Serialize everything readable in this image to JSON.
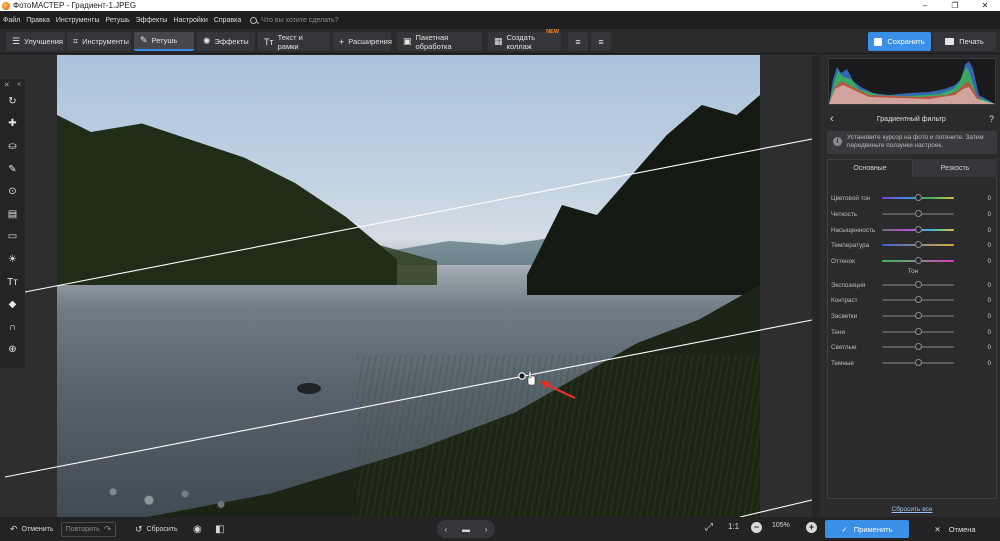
{
  "window": {
    "title": "ФотоМАСТЕР - Градиент-1.JPEG",
    "minimize": "–",
    "maximize": "❐",
    "close": "✕"
  },
  "menu": {
    "items": [
      "Файл",
      "Правка",
      "Инструменты",
      "Ретушь",
      "Эффекты",
      "Настройки",
      "Справка"
    ],
    "search_placeholder": "Что вы хотите сделать?"
  },
  "toolbar": {
    "tabs": [
      {
        "label": "Улучшения",
        "icon": "☰"
      },
      {
        "label": "Инструменты",
        "icon": "⌗"
      },
      {
        "label": "Ретушь",
        "icon": "✎"
      },
      {
        "label": "Эффекты",
        "icon": "✺"
      },
      {
        "label": "Текст и рамки",
        "icon": "Tт"
      },
      {
        "label": "Расширения",
        "icon": "+"
      },
      {
        "label": "Пакетная обработка",
        "icon": "▣"
      },
      {
        "label": "Создать коллаж",
        "icon": "▦",
        "badge": "NEW"
      }
    ],
    "extra1": "≡",
    "extra2": "≡",
    "save_label": "Сохранить",
    "print_label": "Печать"
  },
  "left_tools": {
    "collapse_close": "✕",
    "collapse_arrow": "«",
    "icons": [
      "↻",
      "✚",
      "⛀",
      "✎",
      "⊙",
      "▤",
      "▭",
      "☀",
      "Tт",
      "◆",
      "∩",
      "⊕"
    ]
  },
  "panel": {
    "back": "‹",
    "title": "Градиентный фильтр",
    "help": "?",
    "info_icon": "i",
    "info_text": "Установите курсор на фото и потяните. Затем передвиньте ползунки настроек.",
    "tabs": [
      "Основные",
      "Резкость"
    ],
    "color_sliders": [
      {
        "label": "Цветовой тон",
        "value": "0"
      },
      {
        "label": "Четкость",
        "value": "0"
      },
      {
        "label": "Насыщенность",
        "value": "0"
      },
      {
        "label": "Температура",
        "value": "0"
      },
      {
        "label": "Оттенок",
        "value": "0"
      }
    ],
    "tone_label": "Тон",
    "tone_sliders": [
      {
        "label": "Экспозиция",
        "value": "0"
      },
      {
        "label": "Контраст",
        "value": "0"
      },
      {
        "label": "Засветки",
        "value": "0"
      },
      {
        "label": "Тени",
        "value": "0"
      },
      {
        "label": "Светлые",
        "value": "0"
      },
      {
        "label": "Темные",
        "value": "0"
      }
    ],
    "reset_all": "Сбросить все"
  },
  "bottom": {
    "undo": "Отменить",
    "undo_icon": "↶",
    "redo": "Повторить",
    "redo_icon": "↷",
    "reset": "Сбросить",
    "reset_icon": "↺",
    "eye_icon": "◉",
    "compare_icon": "◧",
    "nav_prev": "‹",
    "nav_folder": "▬",
    "nav_next": "›",
    "fit_icon": "⤢",
    "one_to_one": "1:1",
    "zoom_out": "−",
    "zoom_value": "105%",
    "zoom_in": "+",
    "apply": "Применить",
    "apply_icon": "✓",
    "cancel": "Отмена",
    "cancel_icon": "✕"
  },
  "colors": {
    "accent": "#3a8fe6",
    "new_badge": "#ff8a1f",
    "arrow": "#e0312b"
  }
}
